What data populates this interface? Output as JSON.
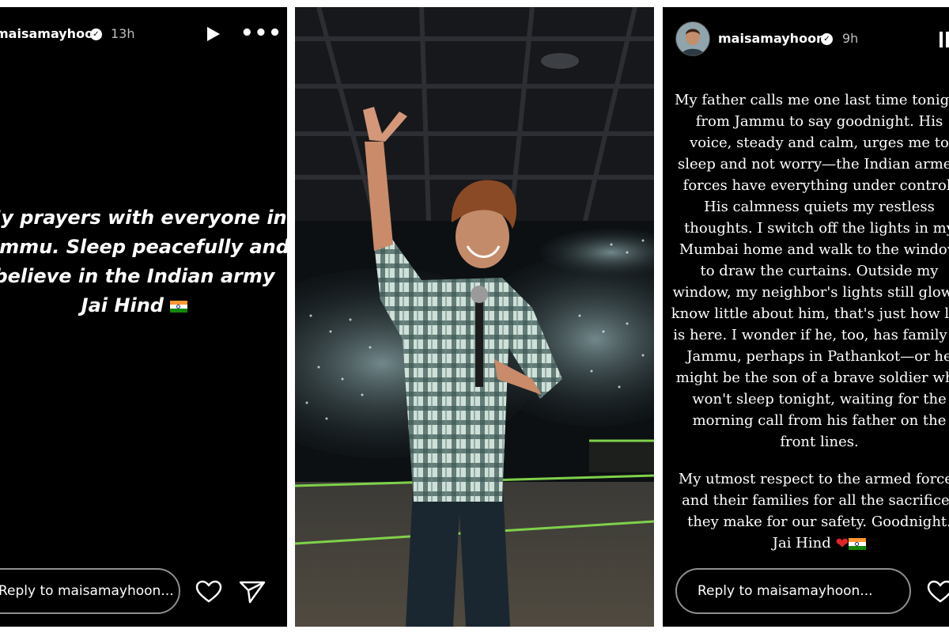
{
  "left_story": {
    "username": "maisamayhoon",
    "time_ago": "13h",
    "message_lines": [
      "My prayers with everyone in",
      "Jammu. Sleep peacefully and",
      "believe in the Indian army",
      "Jai Hind"
    ],
    "reply_placeholder": "Reply to maisamayhoon..."
  },
  "right_story": {
    "username": "maisamayhoon",
    "time_ago": "9h",
    "paragraph1_lines": [
      "My father calls me one last time tonight",
      "from Jammu to say goodnight. His",
      "voice, steady and calm, urges me to",
      "sleep and not worry—the Indian armed",
      "forces have everything under control.",
      "His calmness quiets my restless",
      "thoughts. I switch off the lights in my",
      "Mumbai home and walk to the window",
      "to draw the curtains. Outside my",
      "window, my neighbor's lights still glow. I",
      "know little about him, that's just how life",
      "is here. I wonder if he, too, has family in",
      "Jammu, perhaps in Pathankot—or he",
      "might be the son of a brave soldier who",
      "won't sleep tonight, waiting for the",
      "morning call from his father on the",
      "front lines."
    ],
    "paragraph2_lines": [
      "My utmost respect to the armed forces",
      "and their families for all the sacrifices",
      "they make for our safety. Goodnight.",
      "Jai Hind"
    ],
    "reply_placeholder": "Reply to maisamayhoon..."
  },
  "icons": {
    "play": "play-icon",
    "more": "more-icon",
    "pause": "pause-icon",
    "heart": "heart-icon",
    "send": "send-icon",
    "verified": "verified-badge-icon"
  },
  "colors": {
    "story_background": "#000000",
    "reply_border": "#8e8e8e",
    "time_text": "#bdbdbd"
  }
}
